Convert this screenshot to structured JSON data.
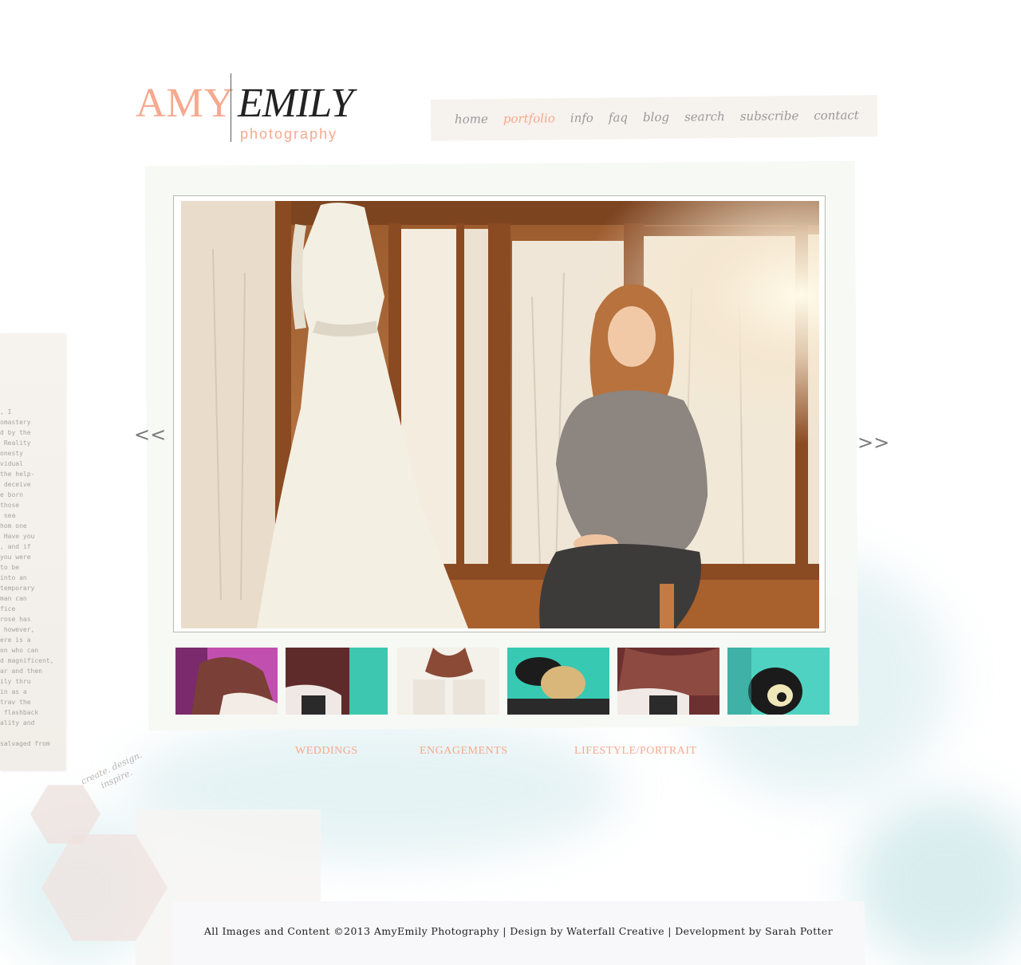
{
  "logo": {
    "first": "AMY",
    "last": "EMILY",
    "sub": "photography",
    "accent_color": "#f7a98e"
  },
  "nav": {
    "items": [
      {
        "label": "home"
      },
      {
        "label": "portfolio",
        "active": true
      },
      {
        "label": "info"
      },
      {
        "label": "faq"
      },
      {
        "label": "blog"
      },
      {
        "label": "search"
      },
      {
        "label": "subscribe"
      },
      {
        "label": "contact"
      }
    ]
  },
  "slideshow": {
    "prev_label": "<<",
    "next_label": ">>",
    "thumbnail_count": 6
  },
  "categories": [
    {
      "label": "WEDDINGS"
    },
    {
      "label": "ENGAGEMENTS"
    },
    {
      "label": "LIFESTYLE/PORTRAIT"
    }
  ],
  "decor": {
    "script_text": "create. design. inspire."
  },
  "footer": {
    "text": "All Images and Content ©2013 AmyEmily Photography | Design by Waterfall Creative | Development by Sarah Potter"
  }
}
